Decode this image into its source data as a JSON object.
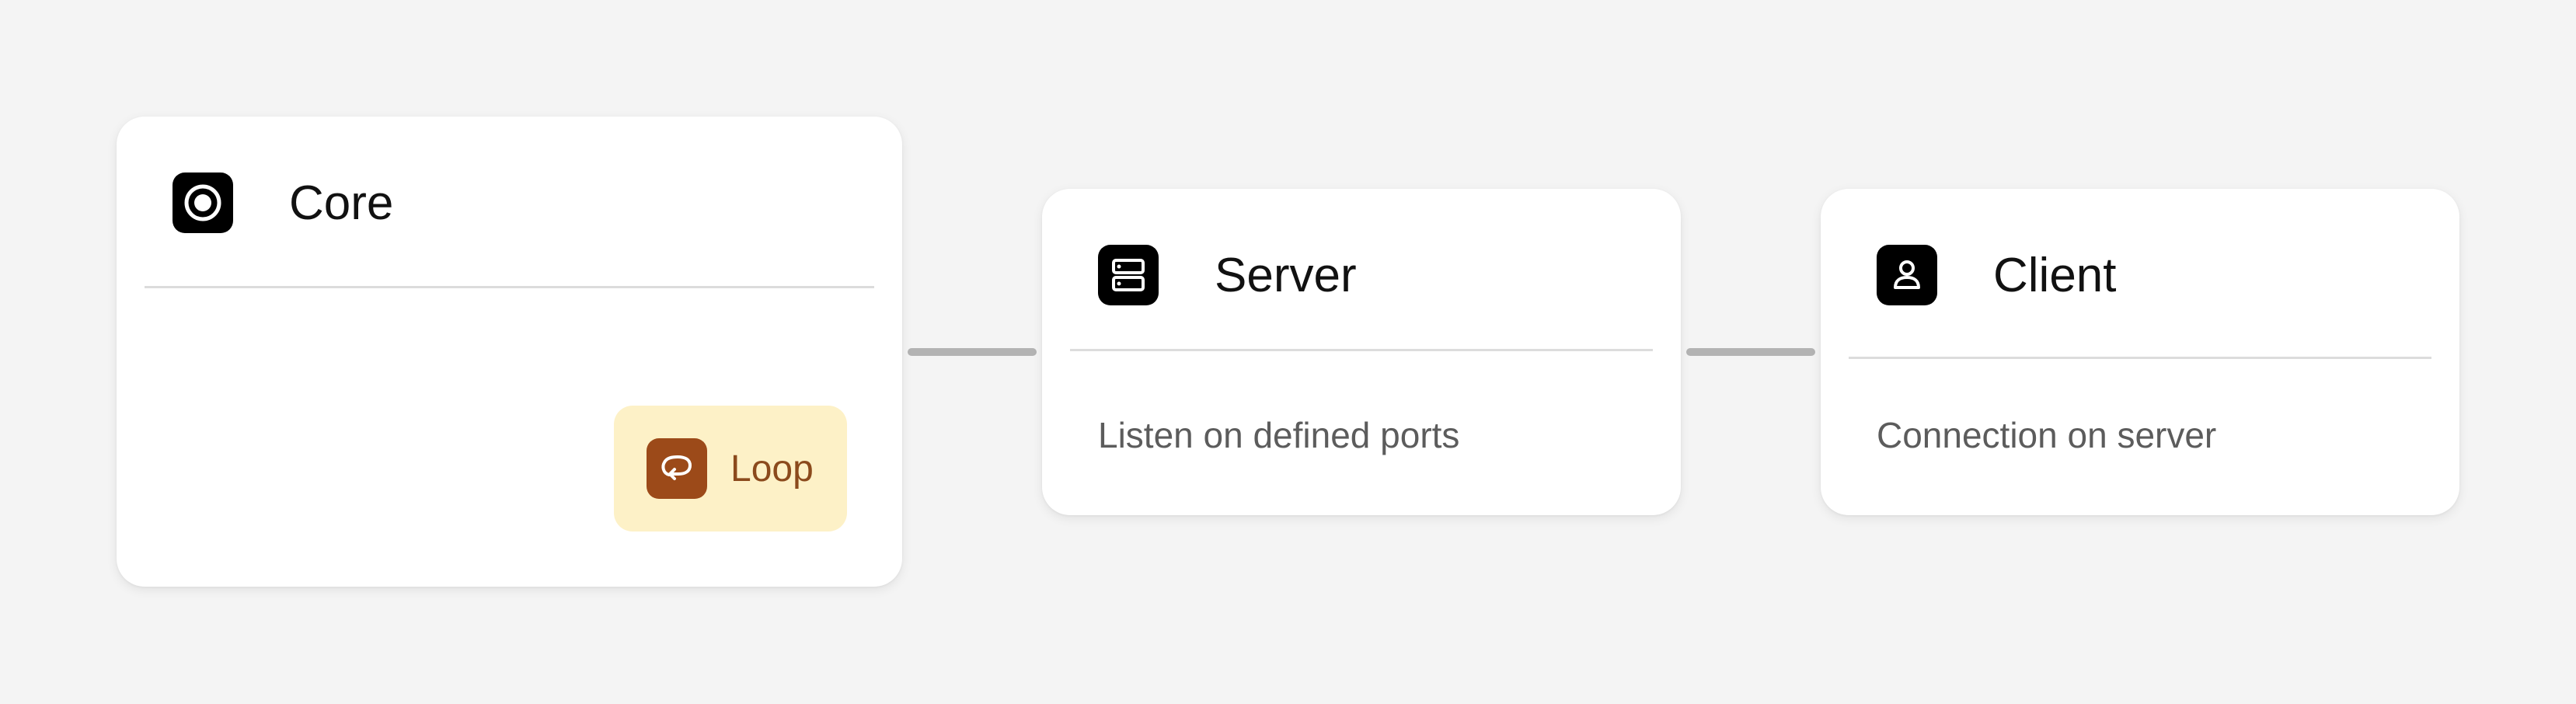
{
  "nodes": {
    "core": {
      "title": "Core",
      "icon": "record-icon",
      "chip": {
        "label": "Loop",
        "icon": "loop-icon",
        "background": "#fdf1c7",
        "icon_color": "#9c4a19",
        "text_color": "#8b4a1c"
      }
    },
    "server": {
      "title": "Server",
      "icon": "server-icon",
      "description": "Listen on defined ports"
    },
    "client": {
      "title": "Client",
      "icon": "user-icon",
      "description": "Connection on server"
    }
  },
  "edges": [
    {
      "from": "Core",
      "to": "Server"
    },
    {
      "from": "Server",
      "to": "Client"
    }
  ],
  "colors": {
    "background": "#f4f4f4",
    "card": "#ffffff",
    "icon_bg": "#000000",
    "edge": "#b3b3b3"
  }
}
